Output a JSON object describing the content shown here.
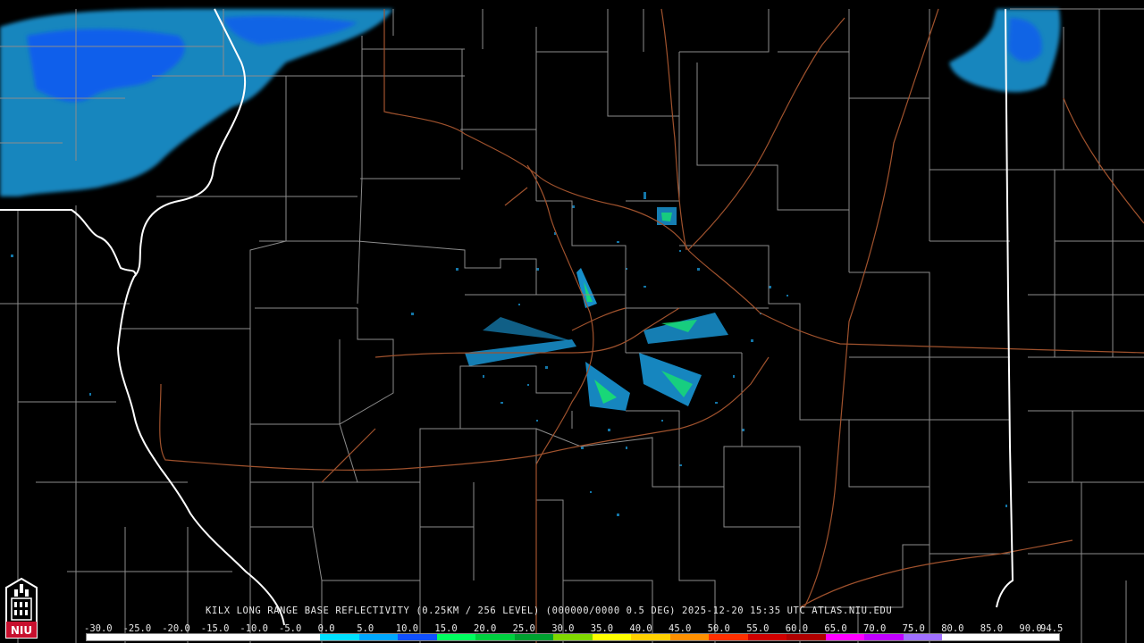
{
  "caption": "KILX LONG RANGE BASE REFLECTIVITY (0.25KM / 256 LEVEL) (000000/0000 0.5 DEG) 2025-12-20 15:35 UTC  ATLAS.NIU.EDU",
  "scale": [
    "-30.0",
    "-25.0",
    "-20.0",
    "-15.0",
    "-10.0",
    "-5.0",
    "0.0",
    "5.0",
    "10.0",
    "15.0",
    "20.0",
    "25.0",
    "30.0",
    "35.0",
    "40.0",
    "45.0",
    "50.0",
    "55.0",
    "60.0",
    "65.0",
    "70.0",
    "75.0",
    "80.0",
    "85.0",
    "90.0",
    "94.5"
  ],
  "colorbar": [
    "#ffffff",
    "#ffffff",
    "#ffffff",
    "#ffffff",
    "#ffffff",
    "#ffffff",
    "#00e0ff",
    "#00a8ff",
    "#1050ff",
    "#00ff60",
    "#00d040",
    "#00a030",
    "#80d800",
    "#ffff00",
    "#ffd000",
    "#ff9000",
    "#ff3000",
    "#d00000",
    "#b00000",
    "#ff00ff",
    "#c000ff",
    "#a070ff",
    "#ffffff",
    "#ffffff",
    "#ffffff"
  ],
  "logo": {
    "text": "NIU",
    "color": "#c8102e"
  },
  "colors": {
    "county": "#8c8c8c",
    "state": "#ffffff",
    "road": "#a0522d",
    "echo_light": "#1ba8e8",
    "echo_mid": "#1050ff",
    "echo_strong": "#18e070"
  }
}
